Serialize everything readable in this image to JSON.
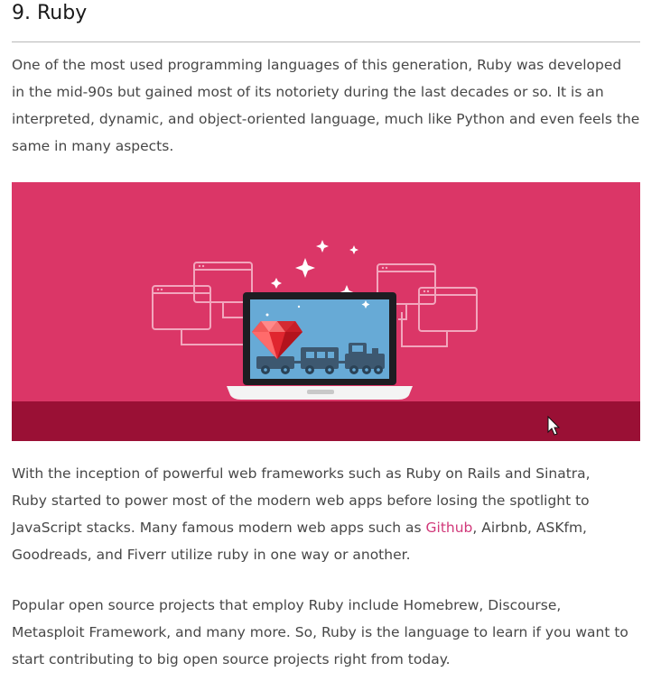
{
  "article": {
    "heading": "9. Ruby",
    "intro": [
      "One of the most used programming languages of this generation, Ruby was developed",
      "in the mid-90s but gained most of its notoriety during the last decades or so. It is an",
      "interpreted, dynamic, and object-oriented language, much like Python and even feels the",
      "same in many aspects."
    ],
    "frameworks": {
      "line1": "With the inception of powerful web frameworks such as Ruby on Rails and Sinatra,",
      "line2": "Ruby started to power most of the modern web apps before losing the spotlight to",
      "line3_before": "JavaScript stacks. Many famous modern web apps such as ",
      "line3_link": "Github",
      "line3_after": ", Airbnb, ASKfm,",
      "line4": "Goodreads, and Fiverr utilize ruby in one way or another."
    },
    "projects": [
      "Popular open source projects that employ Ruby include Homebrew, Discourse,",
      "Metasploit Framework, and many more. So, Ruby is the language to learn if you want to",
      "start contributing to big open source projects right from today."
    ]
  },
  "colors": {
    "hero_bg": "#db3667",
    "hero_floor": "#9a1035",
    "link": "#d1397a",
    "gem": "#e0262f",
    "screen": "#67aad6"
  },
  "icons": {
    "illustration": "laptop-ruby-gem-train-illustration",
    "cursor": "mouse-pointer-icon"
  }
}
